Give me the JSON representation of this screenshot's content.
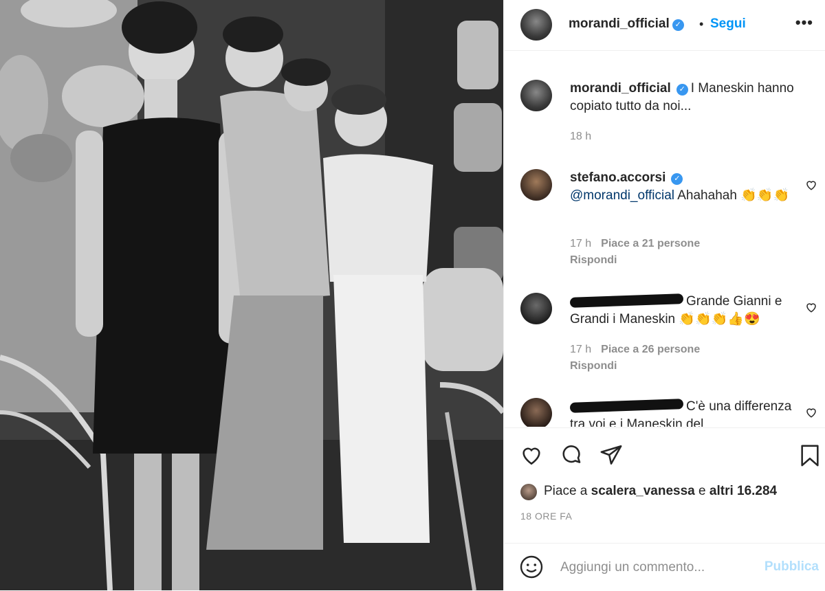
{
  "post": {
    "username": "morandi_official",
    "follow_label": "Segui",
    "more_label": "•••",
    "caption": {
      "username": "morandi_official",
      "text": "I Maneskin hanno copiato tutto da noi...",
      "time": "18 h"
    }
  },
  "comments": [
    {
      "username": "stefano.accorsi",
      "mention": "@morandi_official",
      "text": "Ahahahah 👏👏👏",
      "time": "17 h",
      "likes": "Piace a 21 persone",
      "reply": "Rispondi"
    },
    {
      "username": "",
      "text": "Grande Gianni e Grandi i Maneskin 👏👏👏👍😍",
      "time": "17 h",
      "likes": "Piace a 26 persone",
      "reply": "Rispondi"
    },
    {
      "username": "",
      "text": "C'è una differenza tra voi e i Maneskin del"
    }
  ],
  "likes": {
    "prefix": "Piace a",
    "user": "scalera_vanessa",
    "middle": "e",
    "others": "altri 16.284"
  },
  "post_time": "18 ORE FA",
  "add_comment": {
    "placeholder": "Aggiungi un commento...",
    "publish_label": "Pubblica"
  },
  "icons": [
    "heart-icon",
    "comment-icon",
    "share-icon",
    "bookmark-icon",
    "emoji-icon",
    "verified-icon",
    "more-icon"
  ],
  "colors": {
    "link": "#0095f6",
    "verified": "#3897f0",
    "muted": "#8e8e8e",
    "publish_disabled": "#b2dffc"
  }
}
